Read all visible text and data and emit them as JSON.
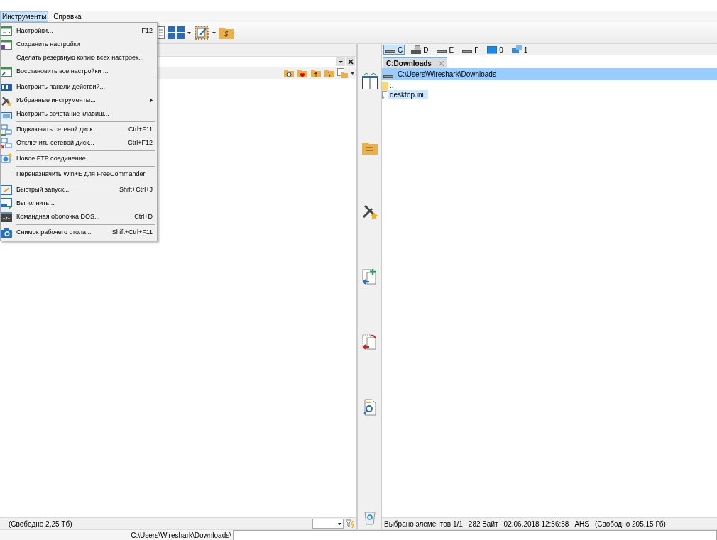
{
  "menubar": [
    {
      "label": "Инструменты",
      "selected": true
    },
    {
      "label": "Справка",
      "selected": false
    }
  ],
  "menu": {
    "groups": [
      [
        {
          "label": "Настройки...",
          "shortcut": "F12"
        },
        {
          "label": "Сохранить настройки"
        },
        {
          "label": "Сделать резервную копию всех настроек..."
        },
        {
          "label": "Восстановить все настройки ..."
        }
      ],
      [
        {
          "label": "Настроить панели действий..."
        },
        {
          "label": "Избранные инструменты...",
          "has_submenu": true
        },
        {
          "label": "Настроить сочетание клавиш..."
        }
      ],
      [
        {
          "label": "Подключить сетевой диск...",
          "shortcut": "Ctrl+F11"
        },
        {
          "label": "Отключить сетевой диск...",
          "shortcut": "Ctrl+F12"
        }
      ],
      [
        {
          "label": "Новое FTP соединение..."
        }
      ],
      [
        {
          "label": "Переназначить Win+E для FreeCommander"
        }
      ],
      [
        {
          "label": "Быстрый запуск...",
          "shortcut": "Shift+Ctrl+J"
        },
        {
          "label": "Выполнить..."
        },
        {
          "label": "Командная оболочка DOS...",
          "shortcut": "Ctrl+D"
        }
      ],
      [
        {
          "label": "Снимок рабочего стола...",
          "shortcut": "Shift+Ctrl+F11"
        }
      ]
    ]
  },
  "right_panel": {
    "drives": [
      {
        "label": "C",
        "kind": "disk",
        "selected": true
      },
      {
        "label": "D",
        "kind": "cdrom",
        "selected": false
      },
      {
        "label": "E",
        "kind": "disk",
        "selected": false
      },
      {
        "label": "F",
        "kind": "disk",
        "selected": false
      },
      {
        "label": "0",
        "kind": "monitor",
        "selected": false
      },
      {
        "label": "1",
        "kind": "network",
        "selected": false
      }
    ],
    "tabs": [
      {
        "label": "C:Downloads",
        "selected": true
      }
    ],
    "path": "C:\\Users\\Wireshark\\Downloads",
    "files": [
      {
        "name": "..",
        "kind": "folder",
        "selected": false
      },
      {
        "name": "desktop.ini",
        "kind": "file",
        "selected": true
      }
    ]
  },
  "status_bar": {
    "left": "(Свободно 2,25 Тб)",
    "right": [
      "Выбрано элементов 1/1",
      "282 Байт",
      "02.06.2018 12:56:58",
      "AHS",
      "(Свободно 205,15 Гб)"
    ]
  },
  "bottom_bar": {
    "path": "C:\\Users\\Wireshark\\Downloads\\"
  }
}
